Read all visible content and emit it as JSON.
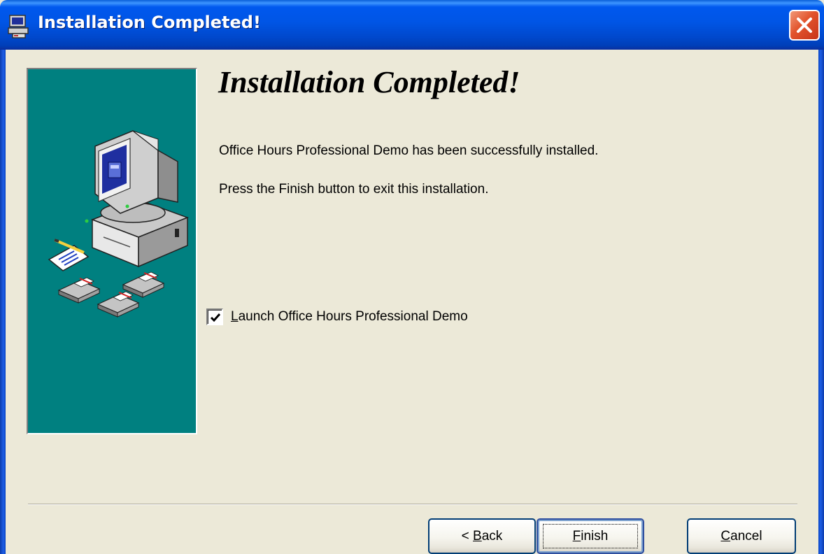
{
  "window": {
    "title": "Installation Completed!"
  },
  "content": {
    "heading": "Installation Completed!",
    "message_installed": "Office Hours Professional Demo has been successfully installed.",
    "message_finish": "Press the Finish button to exit this installation.",
    "launch_checkbox": {
      "checked": true,
      "label_first_char": "L",
      "label_rest": "aunch Office Hours Professional Demo"
    }
  },
  "buttons": {
    "back": {
      "prefix": "< ",
      "mnemonic": "B",
      "rest": "ack"
    },
    "finish": {
      "mnemonic": "F",
      "rest": "inish"
    },
    "cancel": {
      "mnemonic": "C",
      "rest": "ancel"
    }
  },
  "colors": {
    "panel_teal": "#008080",
    "dialog_bg": "#ECE9D8",
    "titlebar_blue": "#0055E5",
    "close_red": "#E2532C"
  },
  "icons": {
    "title": "installer-icon",
    "close": "close-icon",
    "panel": "computer-with-disks-illustration"
  }
}
